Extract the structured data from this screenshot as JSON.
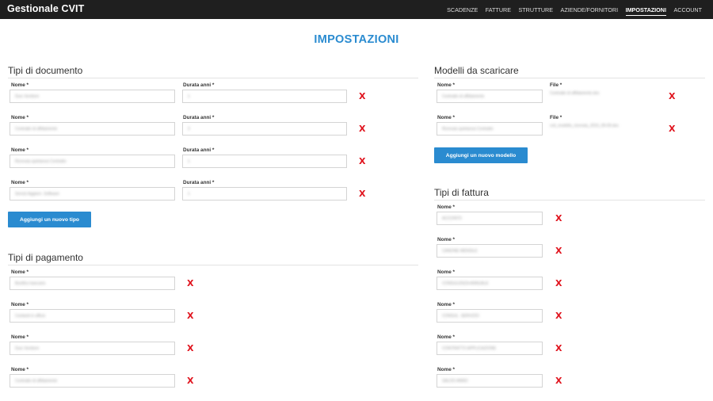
{
  "app": {
    "brand": "Gestionale CVIT"
  },
  "nav": [
    "SCADENZE",
    "FATTURE",
    "STRUTTURE",
    "AZIENDE/FORNITORI",
    "IMPOSTAZIONI",
    "ACCOUNT"
  ],
  "page_title": "IMPOSTAZIONI",
  "remove_symbol": "X",
  "tipi_documento": {
    "title": "Tipi di documento",
    "name_label": "Nome *",
    "duration_label": "Durata anni *",
    "rows": [
      {
        "name": "Durc fornitore",
        "duration": "1"
      },
      {
        "name": "Contratto di affidamento",
        "duration": "3"
      },
      {
        "name": "Ricevuta quietanza Contratto",
        "duration": "1"
      },
      {
        "name": "Servizi Aggiorn. Software",
        "duration": "1"
      }
    ],
    "add_label": "Aggiungi un nuovo tipo"
  },
  "tipi_pagamento": {
    "title": "Tipi di pagamento",
    "name_label": "Nome *",
    "rows": [
      "Bonifico bancario",
      "Contanti in ufficio",
      "Durc fornitore",
      "Contratto di affidamento"
    ]
  },
  "modelli": {
    "title": "Modelli da scaricare",
    "name_label": "Nome *",
    "file_label": "File *",
    "rows": [
      {
        "name": "Contratto di affidamento",
        "file": "Contratto di affidamento.doc"
      },
      {
        "name": "Ricevuta quietanza Contratto",
        "file": "cvit_modello_ricevuta_2015_09-09.doc"
      }
    ],
    "add_label": "Aggiungi un nuovo modello"
  },
  "tipi_fattura": {
    "title": "Tipi di fattura",
    "name_label": "Nome *",
    "rows": [
      "ACCONTO",
      "CANONE MENSILE",
      "CONSULENZA ANNUALE",
      "CONSUL. SERVIZIO",
      "CONTRATTO APPLICAZIONE",
      "SALDO ANNO"
    ]
  }
}
